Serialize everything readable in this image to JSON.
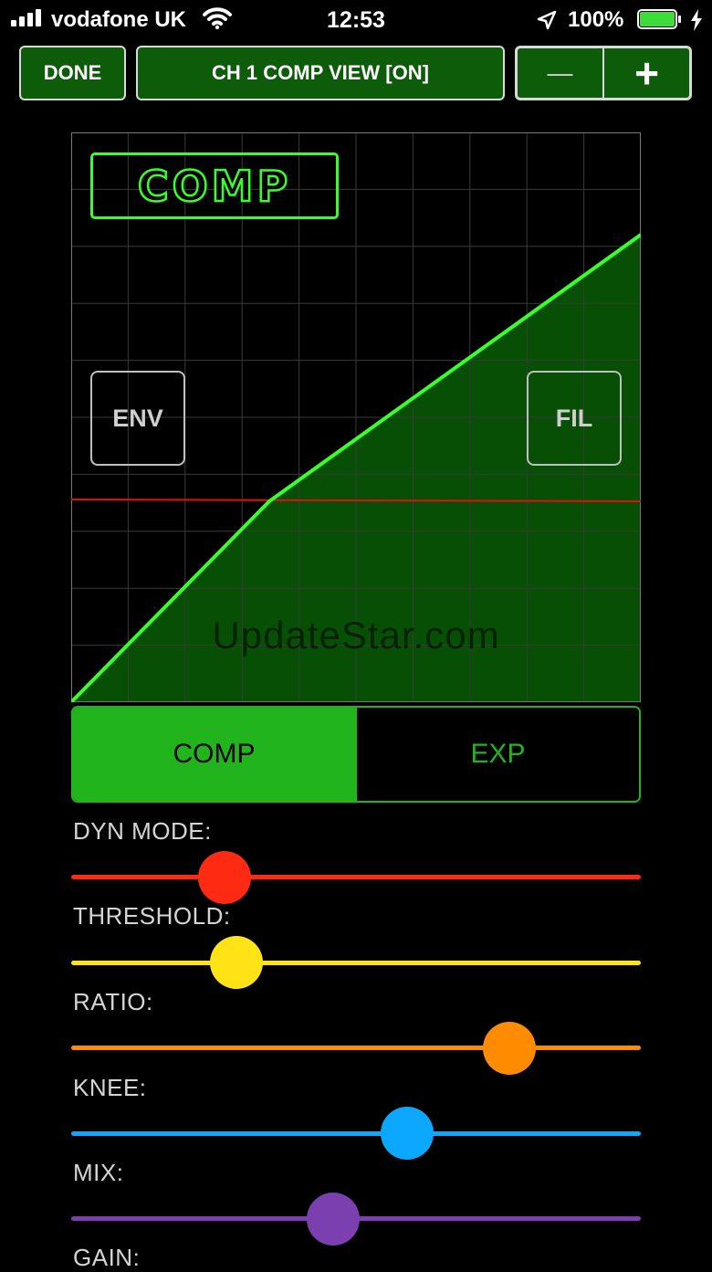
{
  "status_bar": {
    "carrier": "vodafone UK",
    "time": "12:53",
    "battery": "100%"
  },
  "header": {
    "done_label": "DONE",
    "title": "CH 1 COMP VIEW [ON]",
    "minus_label": "—",
    "plus_label": "+"
  },
  "graph": {
    "logo_text": "COMP",
    "env_label": "ENV",
    "fil_label": "FIL",
    "watermark": "UpdateStar.com"
  },
  "mode": {
    "options": [
      "COMP",
      "EXP"
    ],
    "selected": "COMP"
  },
  "sliders": [
    {
      "label": "DYN MODE:",
      "value": 0.27,
      "color": "#ff2a12"
    },
    {
      "label": "THRESHOLD:",
      "value": 0.29,
      "color": "#ffe316"
    },
    {
      "label": "RATIO:",
      "value": 0.77,
      "color": "#ff8c00"
    },
    {
      "label": "KNEE:",
      "value": 0.59,
      "color": "#0ca8ff"
    },
    {
      "label": "MIX:",
      "value": 0.46,
      "color": "#7c3fb0"
    },
    {
      "label": "GAIN:",
      "value": null,
      "color": "#d5d5d5"
    }
  ],
  "colors": {
    "accent_green": "#21b41c",
    "curve": "#37ff2a",
    "fill": "#074f04",
    "threshold_line": "#e01010"
  }
}
